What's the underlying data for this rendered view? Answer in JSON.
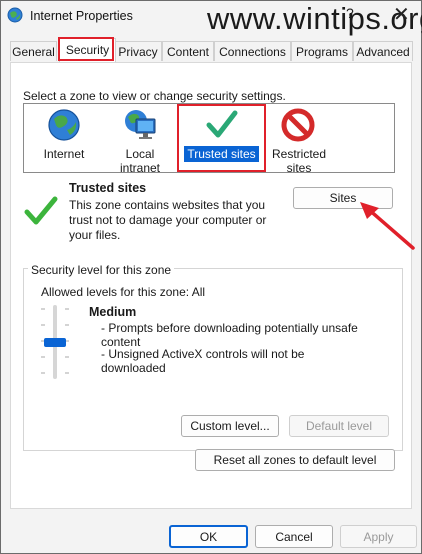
{
  "window": {
    "title": "Internet Properties",
    "watermark": "www.wintips.org",
    "help_glyph": "?",
    "close_glyph": "✕"
  },
  "tabs": [
    {
      "label": "General"
    },
    {
      "label": "Security",
      "active": true
    },
    {
      "label": "Privacy"
    },
    {
      "label": "Content"
    },
    {
      "label": "Connections"
    },
    {
      "label": "Programs"
    },
    {
      "label": "Advanced"
    }
  ],
  "zones": {
    "prompt": "Select a zone to view or change security settings.",
    "items": [
      {
        "label": "Internet",
        "icon": "globe-icon"
      },
      {
        "label": "Local intranet",
        "icon": "monitor-globe-icon"
      },
      {
        "label": "Trusted sites",
        "icon": "checkmark-icon",
        "selected": true
      },
      {
        "label": "Restricted sites",
        "icon": "no-entry-icon"
      }
    ]
  },
  "zone_info": {
    "title": "Trusted sites",
    "description": "This zone contains websites that you trust not to damage your computer or your files.",
    "sites_button": "Sites"
  },
  "security_level": {
    "legend": "Security level for this zone",
    "allowed": "Allowed levels for this zone: All",
    "level_name": "Medium",
    "details": [
      "- Prompts before downloading potentially unsafe",
      "content",
      "- Unsigned ActiveX controls will not be downloaded"
    ],
    "custom_level_button": "Custom level...",
    "default_level_button": "Default level"
  },
  "reset_button": "Reset all zones to default level",
  "footer": {
    "ok": "OK",
    "cancel": "Cancel",
    "apply": "Apply"
  },
  "colors": {
    "highlight_red": "#e0202a",
    "selection_blue": "#0a64d4",
    "check_green": "#2aa876",
    "slider_blue": "#0a64d4"
  }
}
